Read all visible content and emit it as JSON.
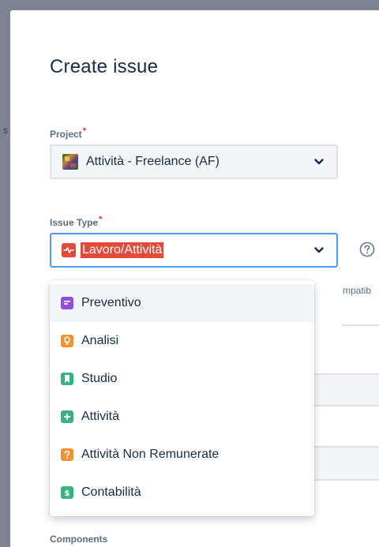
{
  "dialog": {
    "title": "Create issue"
  },
  "project_field": {
    "label": "Project",
    "required_mark": "*",
    "value": "Attività - Freelance (AF)"
  },
  "issue_type_field": {
    "label": "Issue Type",
    "required_mark": "*",
    "value": "Lavoro/Attività"
  },
  "background_fragment": {
    "partial_text": "mpatib",
    "left_edge_text": "s"
  },
  "menu": {
    "options": [
      {
        "label": "Preventivo",
        "icon": "preventivo-icon",
        "color": "#904ee2"
      },
      {
        "label": "Analisi",
        "icon": "lightbulb-icon",
        "color": "#f79232"
      },
      {
        "label": "Studio",
        "icon": "bookmark-icon",
        "color": "#36b37e"
      },
      {
        "label": "Attività",
        "icon": "plus-icon",
        "color": "#36b37e"
      },
      {
        "label": "Attività Non Remunerate",
        "icon": "question-icon",
        "color": "#f79232"
      },
      {
        "label": "Contabilità",
        "icon": "dollar-icon",
        "color": "#36b37e"
      }
    ]
  },
  "components_field": {
    "label": "Components"
  },
  "colors": {
    "selected_type": "#e5493a",
    "focus_border": "#4c9aff",
    "required": "#de350b"
  }
}
